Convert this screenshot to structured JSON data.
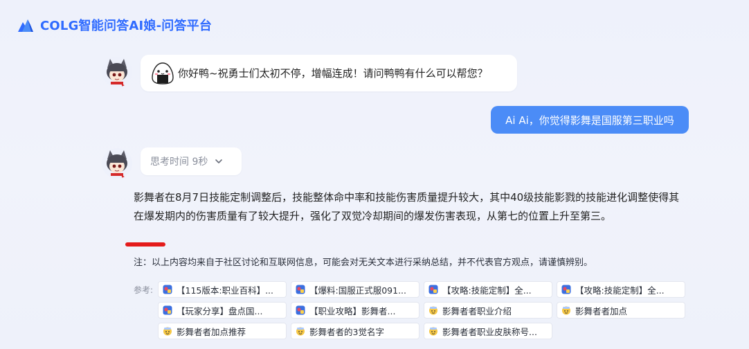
{
  "header": {
    "title": "COLG智能问答AI娘-问答平台"
  },
  "messages": {
    "bot_greeting": "你好鸭~祝勇士们太初不停，增幅连成！请问鸭鸭有什么可以帮您？",
    "user_question": "Ai Ai，你觉得影舞是国服第三职业吗",
    "thinking_label": "思考时间 9秒",
    "answer": "影舞者在8月7日技能定制调整后，技能整体命中率和技能伤害质量提升较大，其中40级技能影戮的技能进化调整使得其在爆发期内的伤害质量有了较大提升，强化了双觉冷却期间的爆发伤害表现，从第七的位置上升至第三。",
    "note": "注：以上内容均来自于社区讨论和互联网信息，可能会对无关文本进行采纳总结，并不代表官方观点，请谨慎辨别。"
  },
  "references": {
    "label": "参考:",
    "items": [
      {
        "label": "【115版本:职业百科】...",
        "icon": "app-icon"
      },
      {
        "label": "【爆料:国服正式服091...",
        "icon": "app-icon"
      },
      {
        "label": "【攻略:技能定制】全...",
        "icon": "app-icon"
      },
      {
        "label": "【攻略:技能定制】全...",
        "icon": "app-icon"
      },
      {
        "label": "【玩家分享】盘点国...",
        "icon": "app-icon"
      },
      {
        "label": "【职业攻略】影舞者...",
        "icon": "app-icon"
      },
      {
        "label": "影舞者者职业介绍",
        "icon": "emoji-icon"
      },
      {
        "label": "影舞者者加点",
        "icon": "emoji-icon"
      },
      {
        "label": "影舞者者加点推荐",
        "icon": "emoji-icon"
      },
      {
        "label": "影舞者者的3觉名字",
        "icon": "emoji-icon"
      },
      {
        "label": "影舞者者职业皮肤称号...",
        "icon": "emoji-icon"
      }
    ]
  },
  "colors": {
    "brand": "#2f6bff",
    "user_bubble": "#4b8cf7",
    "annotation_red": "#e41b1b"
  }
}
